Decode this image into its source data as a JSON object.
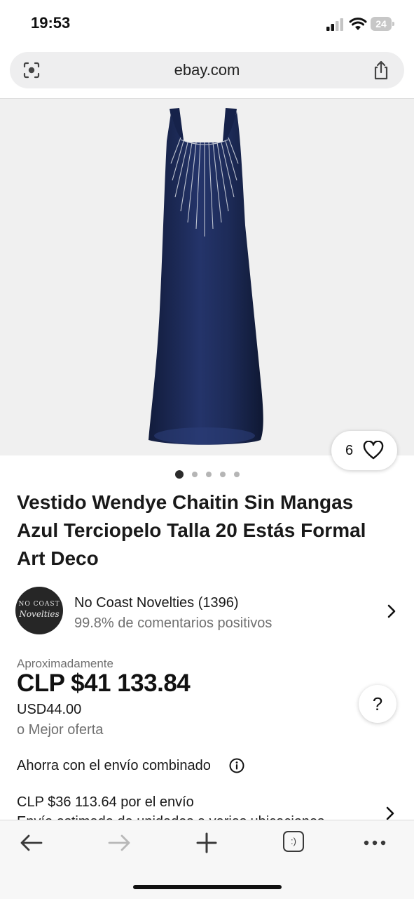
{
  "status_bar": {
    "time": "19:53",
    "battery": "24"
  },
  "browser": {
    "url": "ebay.com"
  },
  "gallery": {
    "image_count": 5,
    "active_index": 0,
    "watch_count": "6"
  },
  "product": {
    "title": "Vestido Wendye Chaitin Sin Mangas Azul Terciopelo Talla 20 Estás Formal Art Deco"
  },
  "seller": {
    "avatar_line1": "NO COAST",
    "avatar_line2": "Novelties",
    "name": "No Coast Novelties (1396)",
    "feedback": "99.8% de comentarios positivos"
  },
  "price": {
    "approx_label": "Aproximadamente",
    "local": "CLP $41 133.84",
    "usd": "USD44.00",
    "best_offer": "o Mejor oferta"
  },
  "help_label": "?",
  "shipping": {
    "combined_label": "Ahorra con el envío combinado",
    "cost": "CLP $36 113.64 por el envío",
    "detail": "Envío estimado de unidades a varias ubicaciones"
  },
  "toolbar": {
    "items": [
      "back",
      "forward",
      "new-tab",
      "tabs",
      "more"
    ],
    "tabs_label": ":)"
  },
  "colors": {
    "accent": "#191919",
    "muted": "#707070",
    "dress": "#1b2850"
  }
}
